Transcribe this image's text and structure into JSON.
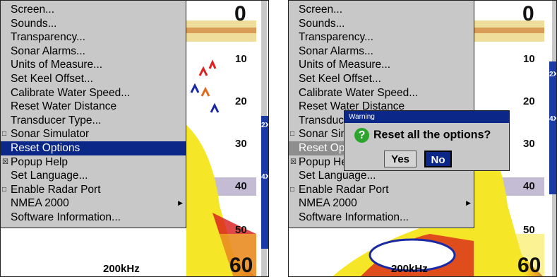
{
  "menu": {
    "items": [
      {
        "label": "Screen...",
        "type": "plain"
      },
      {
        "label": "Sounds...",
        "type": "plain"
      },
      {
        "label": "Transparency...",
        "type": "plain"
      },
      {
        "label": "Sonar Alarms...",
        "type": "plain"
      },
      {
        "label": "Units of Measure...",
        "type": "plain"
      },
      {
        "label": "Set Keel Offset...",
        "type": "plain"
      },
      {
        "label": "Calibrate Water Speed...",
        "type": "plain"
      },
      {
        "label": "Reset Water Distance",
        "type": "plain"
      },
      {
        "label": "Transducer Type...",
        "type": "plain"
      },
      {
        "label": "Sonar Simulator",
        "type": "checkbox",
        "checked": false
      },
      {
        "label": "Reset Options",
        "type": "plain"
      },
      {
        "label": "Popup Help",
        "type": "checkbox",
        "checked": true
      },
      {
        "label": "Set Language...",
        "type": "plain"
      },
      {
        "label": "Enable Radar Port",
        "type": "checkbox",
        "checked": false
      },
      {
        "label": "NMEA 2000",
        "type": "submenu"
      },
      {
        "label": "Software Information...",
        "type": "plain"
      }
    ]
  },
  "depth_scale": [
    "0",
    "10",
    "20",
    "30",
    "40",
    "50",
    "60"
  ],
  "frequency": "200kHz",
  "zoom_labels": [
    "2X",
    "4X"
  ],
  "dialog": {
    "title": "Warning",
    "message": "Reset all the options?",
    "yes": "Yes",
    "no": "No"
  },
  "colors": {
    "menu_bg": "#c8c8c8",
    "selection": "#0b2888",
    "zoom_bar": "#1a3aa5",
    "sonar_yellow": "#f6e628",
    "sonar_red": "#d81a1a"
  }
}
